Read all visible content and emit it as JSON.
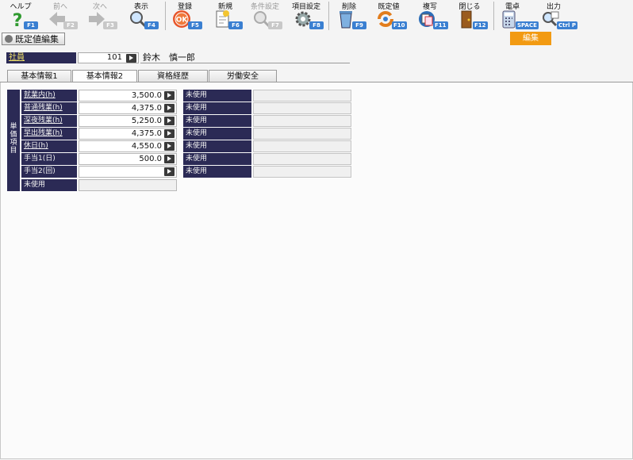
{
  "toolbar": {
    "help": {
      "label": "ヘルプ",
      "key": "F1"
    },
    "prev": {
      "label": "前へ",
      "key": "F2"
    },
    "next": {
      "label": "次へ",
      "key": "F3"
    },
    "view": {
      "label": "表示",
      "key": "F4"
    },
    "register": {
      "label": "登録",
      "key": "F5"
    },
    "new": {
      "label": "新規",
      "key": "F6"
    },
    "condition": {
      "label": "条件設定",
      "key": "F7"
    },
    "item_setting": {
      "label": "項目設定",
      "key": "F8"
    },
    "delete": {
      "label": "削除",
      "key": "F9"
    },
    "default": {
      "label": "既定値",
      "key": "F10"
    },
    "copy": {
      "label": "複写",
      "key": "F11"
    },
    "close": {
      "label": "閉じる",
      "key": "F12"
    },
    "calculator": {
      "label": "電卓",
      "key": "SPACE"
    },
    "output": {
      "label": "出力",
      "key": "Ctrl P"
    }
  },
  "mode_badge": "編集",
  "screen_title": "既定値編集",
  "employee": {
    "label": "社員",
    "code": "101",
    "name": "鈴木　慎一郎"
  },
  "tabs": [
    {
      "label": "基本情報1"
    },
    {
      "label": "基本情報2"
    },
    {
      "label": "資格経歴"
    },
    {
      "label": "労働安全"
    }
  ],
  "group_label": [
    "単",
    "価",
    "項",
    "目"
  ],
  "left_rows": [
    {
      "label": "就業内(h)",
      "value": "3,500.0"
    },
    {
      "label": "普通残業(h)",
      "value": "4,375.0"
    },
    {
      "label": "深夜残業(h)",
      "value": "5,250.0"
    },
    {
      "label": "早出残業(h)",
      "value": "4,375.0"
    },
    {
      "label": "休日(h)",
      "value": "4,550.0"
    },
    {
      "label": "手当1(日)",
      "value": "500.0"
    },
    {
      "label": "手当2(回)",
      "value": ""
    },
    {
      "label": "未使用",
      "value": ""
    }
  ],
  "right_rows": [
    {
      "label": "未使用"
    },
    {
      "label": "未使用"
    },
    {
      "label": "未使用"
    },
    {
      "label": "未使用"
    },
    {
      "label": "未使用"
    },
    {
      "label": "未使用"
    },
    {
      "label": "未使用"
    }
  ],
  "colors": {
    "header_bg": "#2b2a55",
    "accent": "#f29a12",
    "key_badge": "#3a7fd1"
  }
}
